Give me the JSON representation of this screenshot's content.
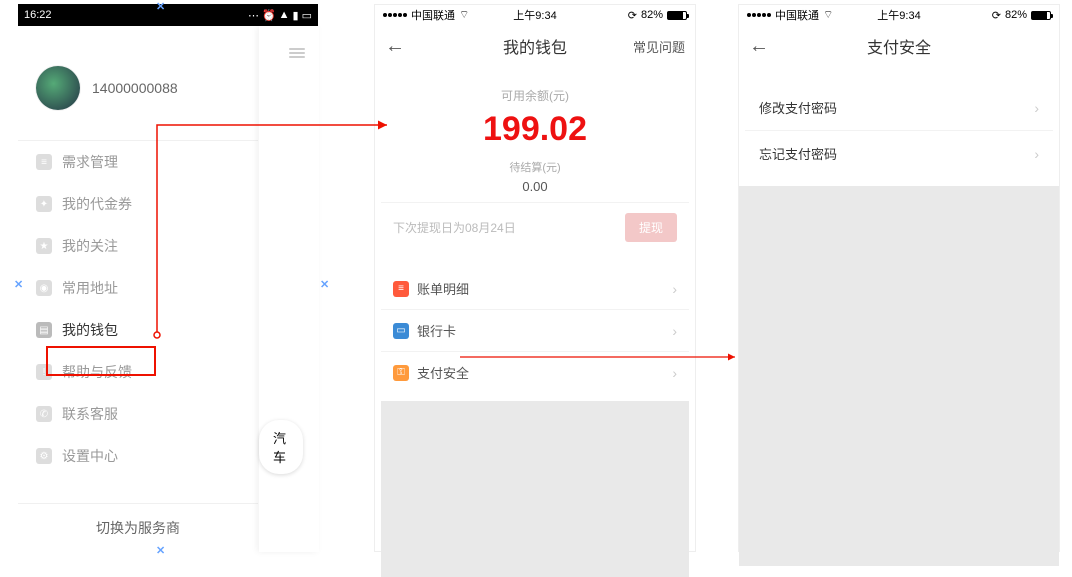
{
  "screen1": {
    "statusbar": {
      "time": "16:22"
    },
    "profile": {
      "phone": "14000000088"
    },
    "menu": [
      {
        "key": "demand",
        "label": "需求管理",
        "icon": "list-icon",
        "color": "#cfcfcf"
      },
      {
        "key": "coupon",
        "label": "我的代金券",
        "icon": "ticket-icon",
        "color": "#cfcfcf"
      },
      {
        "key": "follow",
        "label": "我的关注",
        "icon": "star-icon",
        "color": "#cfcfcf"
      },
      {
        "key": "address",
        "label": "常用地址",
        "icon": "pin-icon",
        "color": "#cfcfcf"
      },
      {
        "key": "wallet",
        "label": "我的钱包",
        "icon": "wallet-icon",
        "color": "#bfbfbf",
        "highlighted": true
      },
      {
        "key": "help",
        "label": "帮助与反馈",
        "icon": "info-icon",
        "color": "#cfcfcf"
      },
      {
        "key": "contact",
        "label": "联系客服",
        "icon": "phone-icon",
        "color": "#cfcfcf"
      },
      {
        "key": "settings",
        "label": "设置中心",
        "icon": "gear-icon",
        "color": "#cfcfcf"
      }
    ],
    "peek_chip": "汽车",
    "footer": "切换为服务商"
  },
  "screen2": {
    "statusbar": {
      "carrier": "中国联通",
      "time": "上午9:34",
      "battery_label": "82%"
    },
    "title": "我的钱包",
    "right_link": "常见问题",
    "balance_label": "可用余额(元)",
    "balance": "199.02",
    "pending_label": "待结算(元)",
    "pending": "0.00",
    "withdraw_hint": "下次提现日为08月24日",
    "withdraw_btn": "提现",
    "items": [
      {
        "key": "bill",
        "label": "账单明细",
        "icon": "receipt-icon",
        "color": "#ff5a3c"
      },
      {
        "key": "card",
        "label": "银行卡",
        "icon": "card-icon",
        "color": "#3b8bd6"
      },
      {
        "key": "security",
        "label": "支付安全",
        "icon": "key-icon",
        "color": "#ff9a3c",
        "highlighted": true
      }
    ]
  },
  "screen3": {
    "statusbar": {
      "carrier": "中国联通",
      "time": "上午9:34",
      "battery_label": "82%"
    },
    "title": "支付安全",
    "items": [
      {
        "key": "change_pwd",
        "label": "修改支付密码",
        "highlighted": true
      },
      {
        "key": "forgot_pwd",
        "label": "忘记支付密码"
      }
    ]
  }
}
